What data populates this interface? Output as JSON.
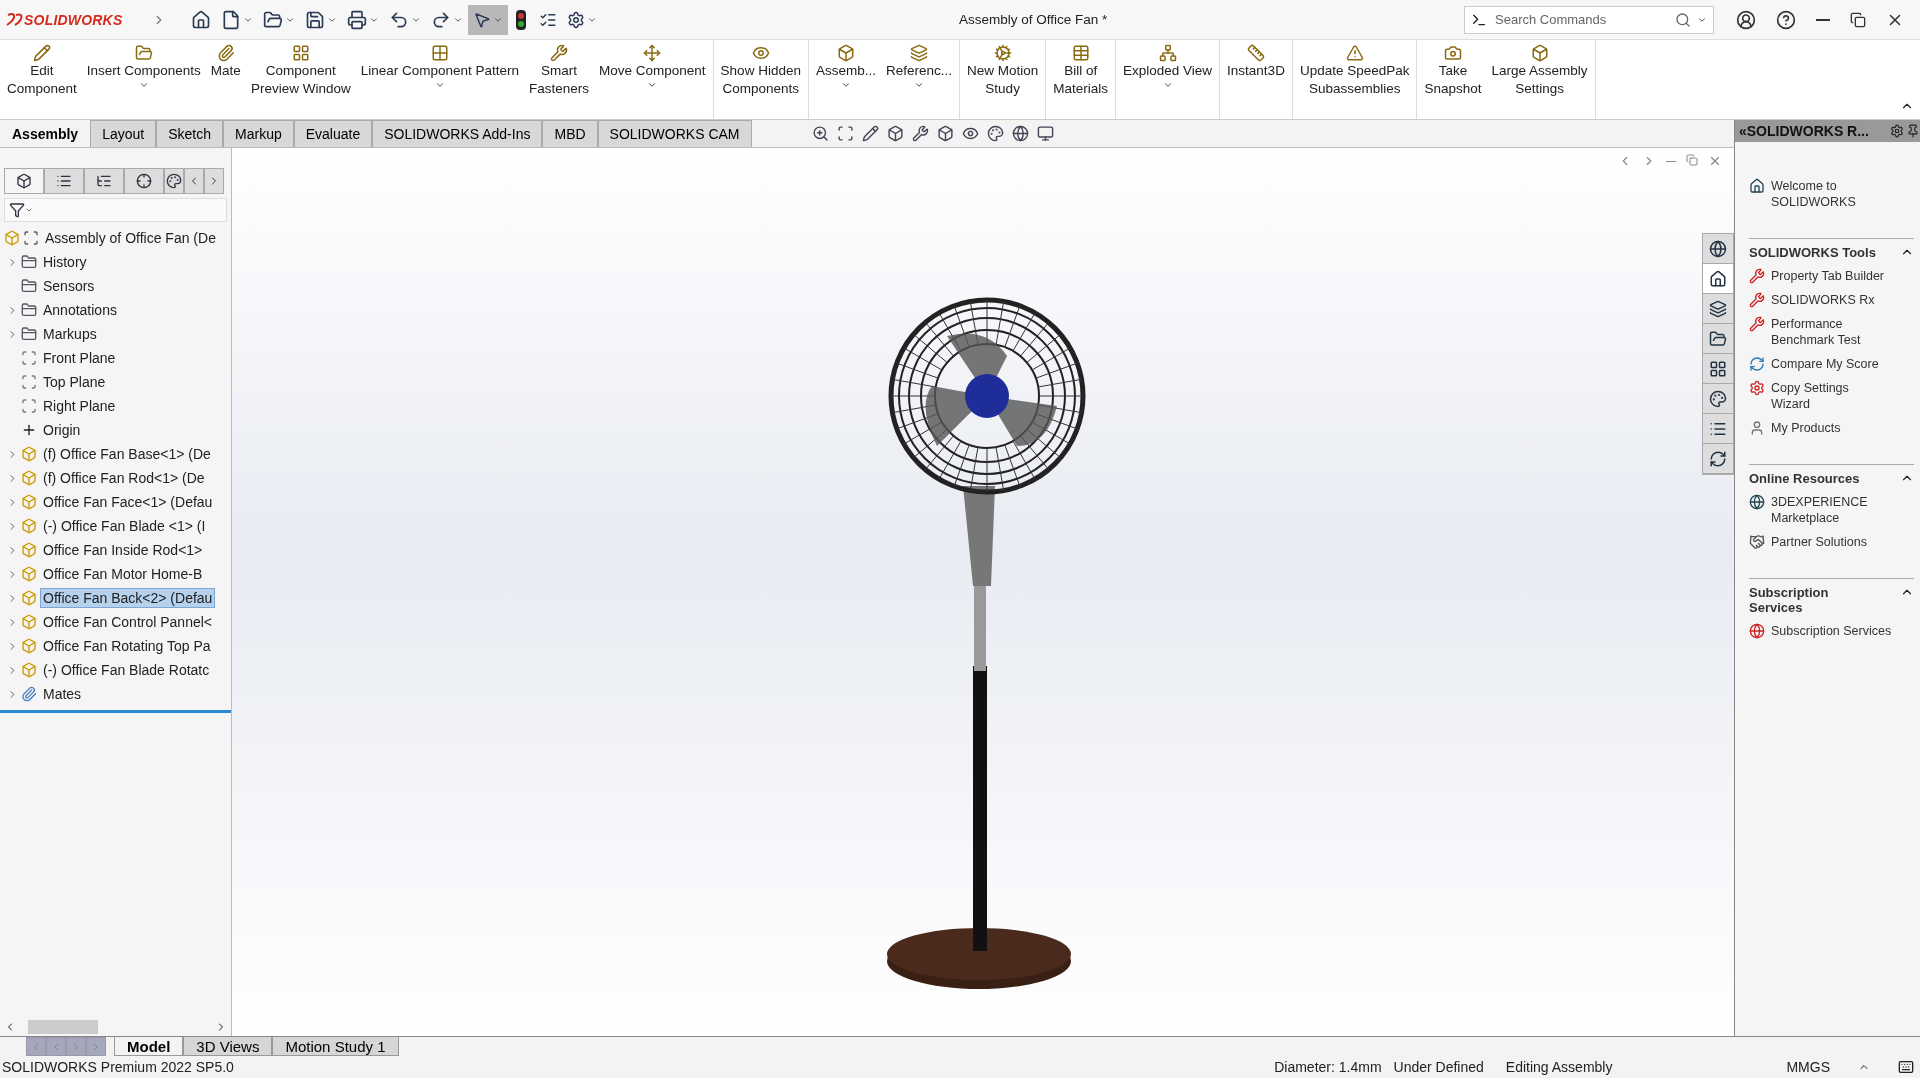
{
  "app": {
    "logo_text": "SOLIDWORKS",
    "title": "Assembly of Office Fan *",
    "search": {
      "placeholder": "Search Commands"
    }
  },
  "ribbon_groups": [
    [
      {
        "label": "Edit\nComponent",
        "dropdown": false
      },
      {
        "label": "Insert Components",
        "dropdown": true
      },
      {
        "label": "Mate",
        "dropdown": false
      },
      {
        "label": "Component\nPreview Window",
        "dropdown": false
      },
      {
        "label": "Linear Component Pattern",
        "dropdown": true
      },
      {
        "label": "Smart\nFasteners",
        "dropdown": false
      },
      {
        "label": "Move Component",
        "dropdown": true
      }
    ],
    [
      {
        "label": "Show Hidden\nComponents",
        "dropdown": false
      }
    ],
    [
      {
        "label": "Assemb...",
        "dropdown": true
      },
      {
        "label": "Referenc...",
        "dropdown": true
      }
    ],
    [
      {
        "label": "New Motion\nStudy",
        "dropdown": false
      }
    ],
    [
      {
        "label": "Bill of\nMaterials",
        "dropdown": false
      }
    ],
    [
      {
        "label": "Exploded View",
        "dropdown": true
      }
    ],
    [
      {
        "label": "Instant3D",
        "dropdown": false
      }
    ],
    [
      {
        "label": "Update SpeedPak\nSubassemblies",
        "dropdown": false
      }
    ],
    [
      {
        "label": "Take\nSnapshot",
        "dropdown": false
      },
      {
        "label": "Large Assembly\nSettings",
        "dropdown": false
      }
    ]
  ],
  "command_tabs": [
    {
      "label": "Assembly",
      "selected": true
    },
    {
      "label": "Layout",
      "selected": false
    },
    {
      "label": "Sketch",
      "selected": false
    },
    {
      "label": "Markup",
      "selected": false
    },
    {
      "label": "Evaluate",
      "selected": false
    },
    {
      "label": "SOLIDWORKS Add-Ins",
      "selected": false
    },
    {
      "label": "MBD",
      "selected": false
    },
    {
      "label": "SOLIDWORKS CAM",
      "selected": false
    }
  ],
  "feature_tree": {
    "root": {
      "label": "Assembly of Office Fan (De",
      "children": [
        {
          "label": "History",
          "kind": "folder",
          "expander": true,
          "selected": false
        },
        {
          "label": "Sensors",
          "kind": "folder",
          "expander": false,
          "selected": false
        },
        {
          "label": "Annotations",
          "kind": "folder",
          "expander": true,
          "selected": false
        },
        {
          "label": "Markups",
          "kind": "folder",
          "expander": true,
          "selected": false
        },
        {
          "label": "Front Plane",
          "kind": "plane",
          "expander": false,
          "selected": false
        },
        {
          "label": "Top Plane",
          "kind": "plane",
          "expander": false,
          "selected": false
        },
        {
          "label": "Right Plane",
          "kind": "plane",
          "expander": false,
          "selected": false
        },
        {
          "label": "Origin",
          "kind": "origin",
          "expander": false,
          "selected": false
        },
        {
          "label": "(f) Office Fan Base<1> (De",
          "kind": "part",
          "expander": true,
          "selected": false
        },
        {
          "label": "(f) Office Fan Rod<1> (De",
          "kind": "part",
          "expander": true,
          "selected": false
        },
        {
          "label": "Office Fan Face<1> (Defau",
          "kind": "part",
          "expander": true,
          "selected": false
        },
        {
          "label": "(-) Office Fan Blade <1> (I",
          "kind": "part",
          "expander": true,
          "selected": false
        },
        {
          "label": "Office Fan Inside Rod<1>",
          "kind": "part",
          "expander": true,
          "selected": false
        },
        {
          "label": "Office Fan Motor Home-B",
          "kind": "part",
          "expander": true,
          "selected": false
        },
        {
          "label": "Office Fan Back<2> (Defau",
          "kind": "part",
          "expander": true,
          "selected": true
        },
        {
          "label": "Office Fan Control Pannel<",
          "kind": "part",
          "expander": true,
          "selected": false
        },
        {
          "label": "Office Fan Rotating Top Pa",
          "kind": "part",
          "expander": true,
          "selected": false
        },
        {
          "label": "(-) Office Fan Blade Rotatc",
          "kind": "part",
          "expander": true,
          "selected": false
        },
        {
          "label": "Mates",
          "kind": "mates",
          "expander": true,
          "selected": false
        }
      ]
    }
  },
  "task_pane": {
    "title": "«SOLIDWORKS R...",
    "welcome": "Welcome to\nSOLIDWORKS",
    "sections": [
      {
        "title": "SOLIDWORKS Tools",
        "expanded": true,
        "items": [
          "Property Tab Builder",
          "SOLIDWORKS Rx",
          "Performance\nBenchmark Test",
          "Compare My Score",
          "Copy Settings\nWizard",
          "My Products"
        ]
      },
      {
        "title": "Online Resources",
        "expanded": true,
        "items": [
          "3DEXPERIENCE\nMarketplace",
          "Partner Solutions"
        ]
      },
      {
        "title": "Subscription\nServices",
        "expanded": true,
        "items": [
          "Subscription Services"
        ]
      }
    ]
  },
  "bottom_tabs": [
    {
      "label": "Model",
      "selected": true
    },
    {
      "label": "3D Views",
      "selected": false
    },
    {
      "label": "Motion Study 1",
      "selected": false
    }
  ],
  "status_bar": {
    "product": "SOLIDWORKS Premium 2022 SP5.0",
    "measure": "Diameter: 1.4mm",
    "definition": "Under Defined",
    "mode": "Editing Assembly",
    "units": "MMGS"
  }
}
